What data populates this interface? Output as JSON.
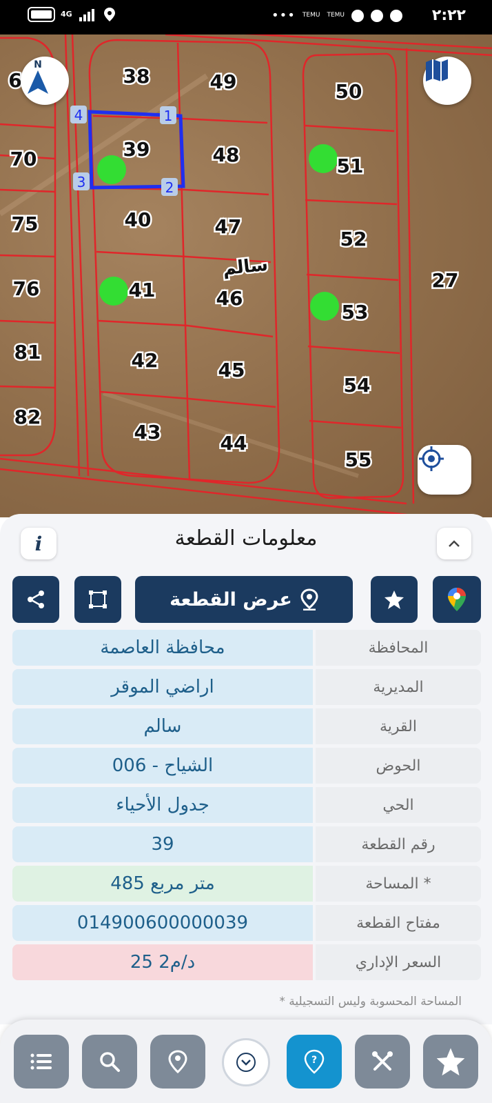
{
  "status_bar": {
    "time": "٢:٢٢",
    "network": "4G",
    "temu_label_1": "TEMU",
    "temu_label_2": "TEMU",
    "more_icon": "ellipsis-icon"
  },
  "map": {
    "north_label": "N",
    "street_label": "سالم",
    "parcels": [
      "6",
      "38",
      "49",
      "50",
      "70",
      "39",
      "48",
      "51",
      "75",
      "40",
      "47",
      "52",
      "76",
      "41",
      "46",
      "53",
      "27",
      "81",
      "42",
      "45",
      "54",
      "82",
      "43",
      "44",
      "55"
    ],
    "vertex_labels": [
      "1",
      "2",
      "3",
      "4"
    ],
    "selected_parcel": "39",
    "highlight_color": "#1f2ff0",
    "line_color": "#e0262a",
    "marker_color": "#33dd33"
  },
  "sheet": {
    "title": "معلومات القطعة",
    "info_icon_text": "i",
    "show_parcel_label": "عرض القطعة",
    "rows": [
      {
        "label": "المحافظة",
        "value": "محافظة العاصمة"
      },
      {
        "label": "المديرية",
        "value": "اراضي الموقر"
      },
      {
        "label": "القرية",
        "value": "سالم"
      },
      {
        "label": "الحوض",
        "value": "الشياح - 006"
      },
      {
        "label": "الحي",
        "value": "جدول الأحياء"
      },
      {
        "label": "رقم القطعة",
        "value": "39"
      },
      {
        "label": "المساحة *",
        "value": "485  متر مربع"
      },
      {
        "label": "مفتاح القطعة",
        "value": "014900600000039"
      },
      {
        "label": "السعر الإداري",
        "value": "25 د/م2"
      }
    ],
    "footnote": "* المساحة المحسوبة وليس التسجيلية"
  },
  "colors": {
    "primary": "#1b3a5f",
    "active_nav": "#1493cf",
    "nav_inactive": "#7e8a98"
  }
}
